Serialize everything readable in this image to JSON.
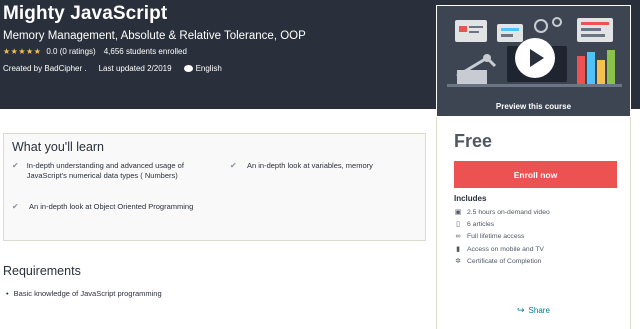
{
  "course": {
    "title": "Mighty JavaScript",
    "subtitle": "Memory Management, Absolute & Relative Tolerance, OOP",
    "stars": "★★★★★",
    "rating": "0.0 (0 ratings)",
    "enrolled": "4,656 students enrolled",
    "created_by": "Created by BadCipher .",
    "last_updated": "Last updated 2/2019",
    "language": "English"
  },
  "preview": {
    "caption": "Preview this course"
  },
  "sidebar": {
    "price": "Free",
    "enroll_label": "Enroll now",
    "includes_title": "Includes",
    "includes": [
      {
        "icon": "video-icon",
        "glyph": "▣",
        "label": "2.5 hours on-demand video"
      },
      {
        "icon": "file-icon",
        "glyph": "▯",
        "label": "6 articles"
      },
      {
        "icon": "infinity-icon",
        "glyph": "∞",
        "label": "Full lifetime access"
      },
      {
        "icon": "mobile-icon",
        "glyph": "▮",
        "label": "Access on mobile and TV"
      },
      {
        "icon": "certificate-icon",
        "glyph": "✲",
        "label": "Certificate of Completion"
      }
    ],
    "share_label": "Share"
  },
  "learn": {
    "title": "What you'll learn",
    "items": [
      "In-depth understanding and advanced usage of JavaScript's numerical data types ( Numbers)",
      "An in-depth look at variables, memory",
      "An in-depth look at Object Oriented Programming"
    ]
  },
  "requirements": {
    "title": "Requirements",
    "items": [
      "Basic knowledge of JavaScript programming"
    ]
  },
  "colors": {
    "hero_bg": "#29303b",
    "enroll_bg": "#ec5252",
    "star": "#f4c150",
    "link": "#007791"
  }
}
